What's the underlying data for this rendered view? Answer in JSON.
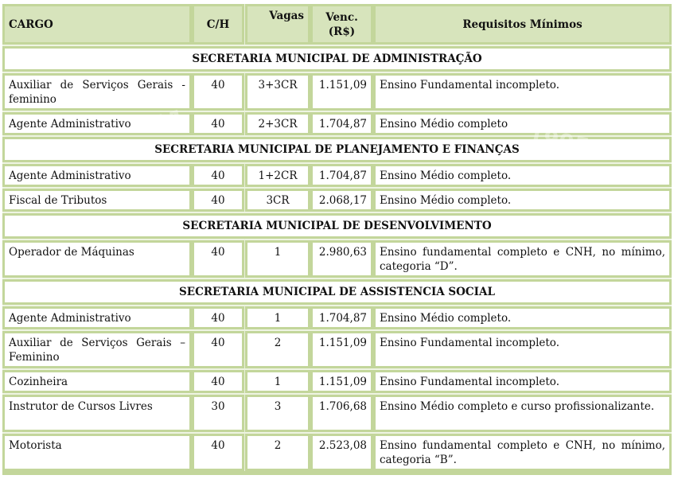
{
  "header": {
    "cargo": "CARGO",
    "ch": "C/H",
    "vagas": "Vagas",
    "venc_line1": "Venc.",
    "venc_line2": "(R$)",
    "requisitos": "Requisitos Mínimos"
  },
  "watermark": {
    "text1": "11",
    "text2": "1995"
  },
  "colors": {
    "frame": "#c3d69b",
    "header_fill": "#d7e4bc",
    "cell_fill": "#ffffff"
  },
  "sections": [
    {
      "title": "SECRETARIA MUNICIPAL DE ADMINISTRAÇÃO",
      "rows": [
        {
          "cargo": "Auxiliar de Serviços Gerais - feminino",
          "ch": "40",
          "vagas": "3+3CR",
          "venc": "1.151,09",
          "requisitos": "Ensino Fundamental incompleto."
        },
        {
          "cargo": "Agente Administrativo",
          "ch": "40",
          "vagas": "2+3CR",
          "venc": "1.704,87",
          "requisitos": "Ensino Médio completo"
        }
      ]
    },
    {
      "title": "SECRETARIA MUNICIPAL DE PLANEJAMENTO E FINANÇAS",
      "rows": [
        {
          "cargo": "Agente Administrativo",
          "ch": "40",
          "vagas": "1+2CR",
          "venc": "1.704,87",
          "requisitos": "Ensino Médio completo."
        },
        {
          "cargo": "Fiscal de Tributos",
          "ch": "40",
          "vagas": "3CR",
          "venc": "2.068,17",
          "requisitos": "Ensino Médio completo."
        }
      ]
    },
    {
      "title": "SECRETARIA MUNICIPAL DE DESENVOLVIMENTO",
      "rows": [
        {
          "cargo": "Operador de Máquinas",
          "ch": "40",
          "vagas": "1",
          "venc": "2.980,63",
          "requisitos": "Ensino fundamental completo e CNH, no mínimo, categoria “D”."
        }
      ]
    },
    {
      "title": "SECRETARIA MUNICIPAL DE ASSISTENCIA SOCIAL",
      "rows": [
        {
          "cargo": "Agente Administrativo",
          "ch": "40",
          "vagas": "1",
          "venc": "1.704,87",
          "requisitos": "Ensino Médio completo."
        },
        {
          "cargo": "Auxiliar de Serviços Gerais – Feminino",
          "ch": "40",
          "vagas": "2",
          "venc": "1.151,09",
          "requisitos": "Ensino Fundamental incompleto."
        },
        {
          "cargo": "Cozinheira",
          "ch": "40",
          "vagas": "1",
          "venc": "1.151,09",
          "requisitos": "Ensino Fundamental incompleto."
        },
        {
          "cargo": "Instrutor de Cursos Livres",
          "ch": "30",
          "vagas": "3",
          "venc": "1.706,68",
          "requisitos": "Ensino Médio completo e curso profissionalizante."
        },
        {
          "cargo": "Motorista",
          "ch": "40",
          "vagas": "2",
          "venc": "2.523,08",
          "requisitos": "Ensino fundamental completo e CNH, no mínimo, categoria “B”."
        }
      ]
    }
  ]
}
